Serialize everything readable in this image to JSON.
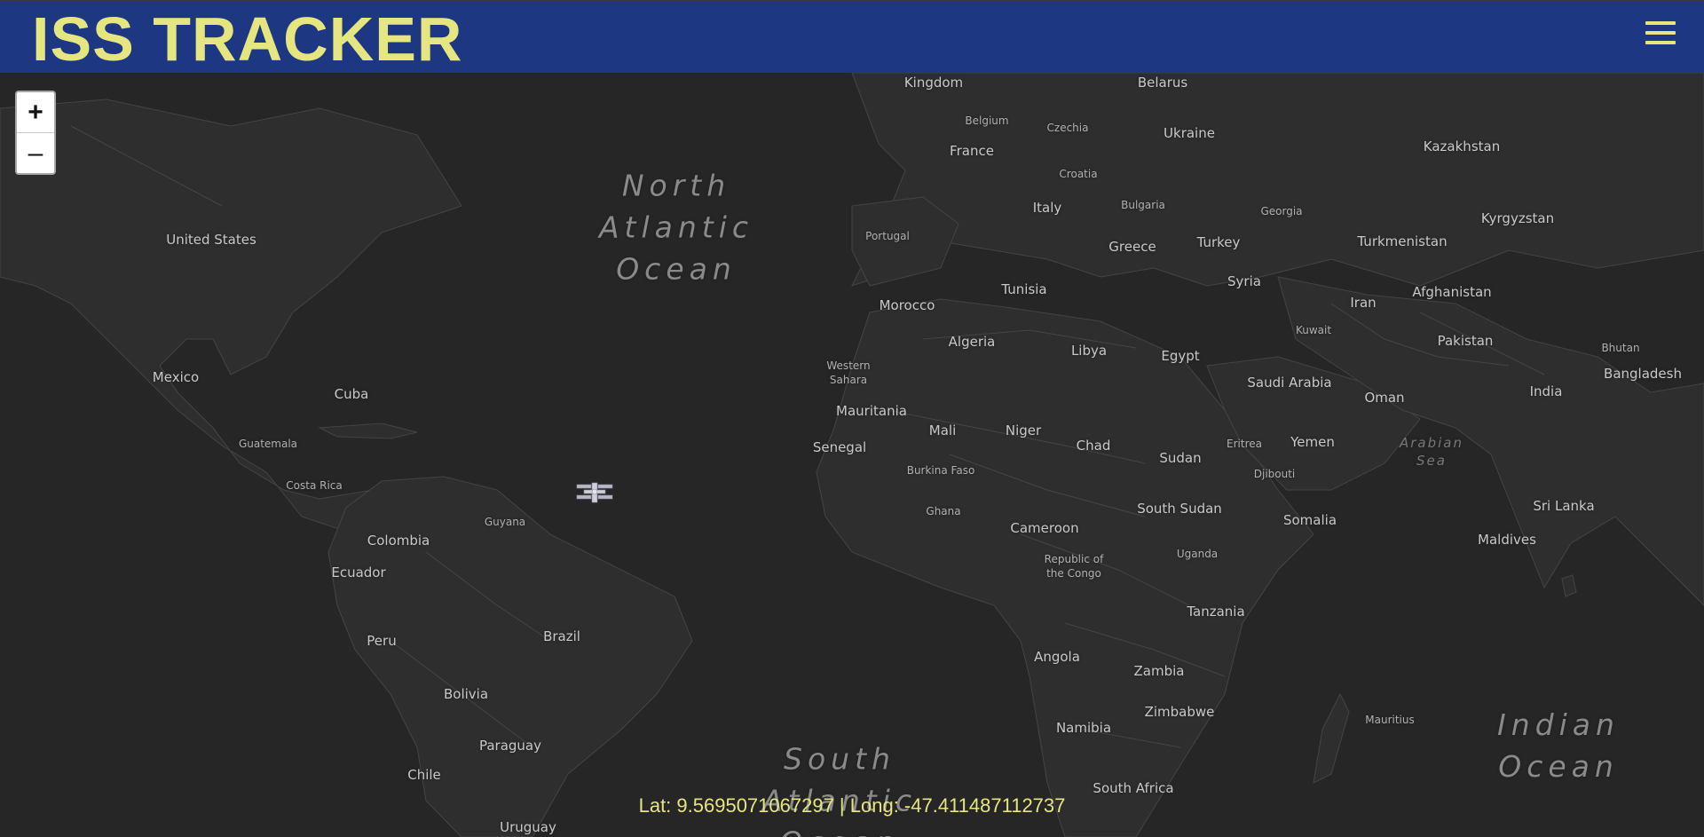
{
  "header": {
    "title": "ISS TRACKER",
    "menu_icon": "hamburger-menu-icon",
    "background_color": "#1e3782",
    "title_color": "#e6e680"
  },
  "map": {
    "zoom_in_label": "+",
    "zoom_out_label": "–",
    "countries": {
      "united_kingdom": "Kingdom",
      "belarus": "Belarus",
      "belgium": "Belgium",
      "czechia": "Czechia",
      "ukraine": "Ukraine",
      "france": "France",
      "kazakhstan": "Kazakhstan",
      "croatia": "Croatia",
      "italy": "Italy",
      "bulgaria": "Bulgaria",
      "georgia": "Georgia",
      "kyrgyzstan": "Kyrgyzstan",
      "portugal": "Portugal",
      "turkey": "Turkey",
      "turkmenistan": "Turkmenistan",
      "greece": "Greece",
      "united_states": "United States",
      "tunisia": "Tunisia",
      "syria": "Syria",
      "afghanistan": "Afghanistan",
      "iran": "Iran",
      "morocco": "Morocco",
      "kuwait": "Kuwait",
      "algeria": "Algeria",
      "libya": "Libya",
      "egypt": "Egypt",
      "pakistan": "Pakistan",
      "bhutan": "Bhutan",
      "western_sahara": "Western\nSahara",
      "mexico": "Mexico",
      "bangladesh": "Bangladesh",
      "saudi_arabia": "Saudi Arabia",
      "cuba": "Cuba",
      "india": "India",
      "oman": "Oman",
      "mauritania": "Mauritania",
      "mali": "Mali",
      "niger": "Niger",
      "guatemala": "Guatemala",
      "yemen": "Yemen",
      "senegal": "Senegal",
      "chad": "Chad",
      "eritrea": "Eritrea",
      "sudan": "Sudan",
      "burkina_faso": "Burkina Faso",
      "djibouti": "Djibouti",
      "costa_rica": "Costa Rica",
      "sri_lanka": "Sri Lanka",
      "ghana": "Ghana",
      "south_sudan": "South Sudan",
      "guyana": "Guyana",
      "somalia": "Somalia",
      "cameroon": "Cameroon",
      "colombia": "Colombia",
      "maldives": "Maldives",
      "uganda": "Uganda",
      "republic_of_the_congo": "Republic of\nthe Congo",
      "ecuador": "Ecuador",
      "tanzania": "Tanzania",
      "brazil": "Brazil",
      "peru": "Peru",
      "angola": "Angola",
      "zambia": "Zambia",
      "bolivia": "Bolivia",
      "zimbabwe": "Zimbabwe",
      "mauritius": "Mauritius",
      "namibia": "Namibia",
      "paraguay": "Paraguay",
      "chile": "Chile",
      "south_africa": "South Africa",
      "uruguay": "Uruguay"
    },
    "oceans": {
      "north_atlantic": "North\nAtlantic\nOcean",
      "south_atlantic": "South\nAtlantic\nOcean",
      "indian": "Indian\nOcean",
      "arabian_sea": "Arabian\nSea"
    },
    "marker_icon": "iss-station-icon"
  },
  "position": {
    "text": "Lat: 9.5695071067297 | Long: -47.411487112737",
    "lat": 9.5695071067297,
    "long": -47.411487112737
  }
}
